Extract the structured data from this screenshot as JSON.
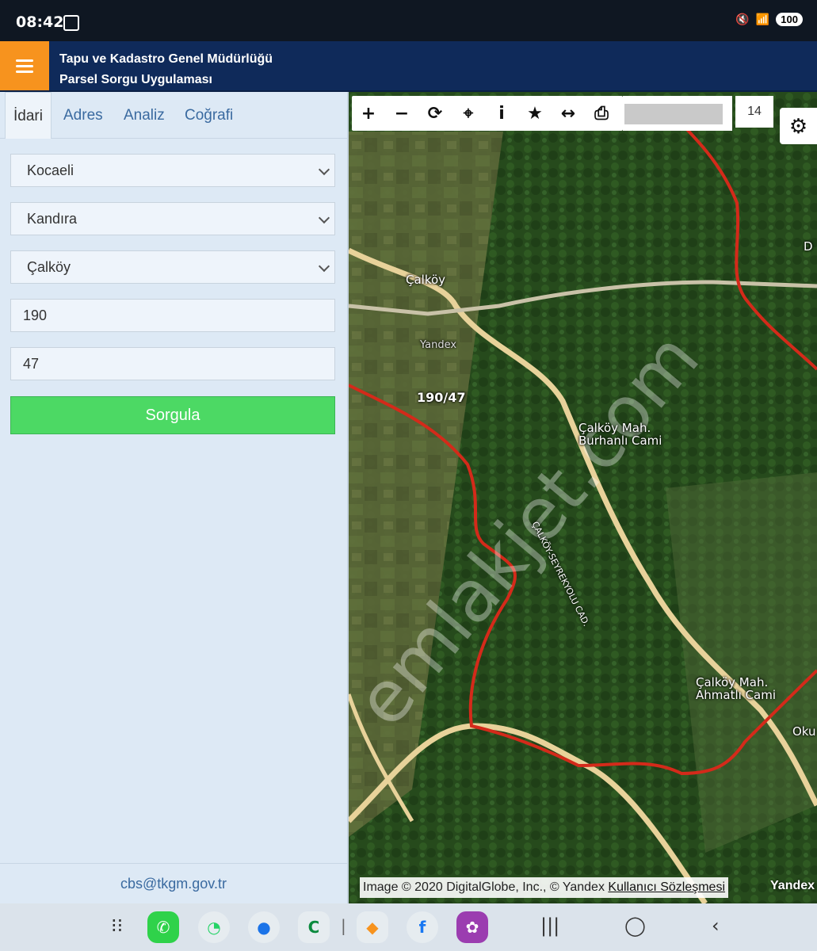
{
  "status_bar": {
    "time": "08:42",
    "battery": "100"
  },
  "app": {
    "title_line1": "Tapu ve Kadastro Genel Müdürlüğü",
    "title_line2": "Parsel Sorgu Uygulaması"
  },
  "tabs": [
    {
      "label": "İdari",
      "active": true
    },
    {
      "label": "Adres"
    },
    {
      "label": "Analiz"
    },
    {
      "label": "Coğrafi"
    }
  ],
  "form": {
    "province": "Kocaeli",
    "district": "Kandıra",
    "neighborhood": "Çalköy",
    "block": "190",
    "parcel": "47",
    "query_label": "Sorgula"
  },
  "footer": {
    "email": "cbs@tkgm.gov.tr"
  },
  "map": {
    "zoom_level": "14",
    "toolbar": [
      "+",
      "−",
      "⟳",
      "⌖",
      "i",
      "★",
      "↔",
      "⎙"
    ],
    "labels": {
      "village": "Çalköy",
      "yandex_small": "Yandex",
      "parcel": "190/47",
      "mosque1_l1": "Çalköy Mah.",
      "mosque1_l2": "Burhanlı Cami",
      "mosque2_l1": "Çalköy Mah.",
      "mosque2_l2": "Ahmatlı Cami",
      "road": "ÇALKÖY-SEYREKYOLU CAD.",
      "edge_right": "Oku",
      "edge_top": "D"
    },
    "watermark": "emlakjet.com",
    "attribution": "Image © 2020 DigitalGlobe, Inc., © Yandex",
    "attribution_link": "Kullanıcı Sözleşmesi",
    "brand": "Yandex"
  },
  "colors": {
    "accent_orange": "#f7931e",
    "header_navy": "#0f2a5a",
    "query_green": "#4cd964",
    "parcel_border_red": "#d42a1a"
  }
}
